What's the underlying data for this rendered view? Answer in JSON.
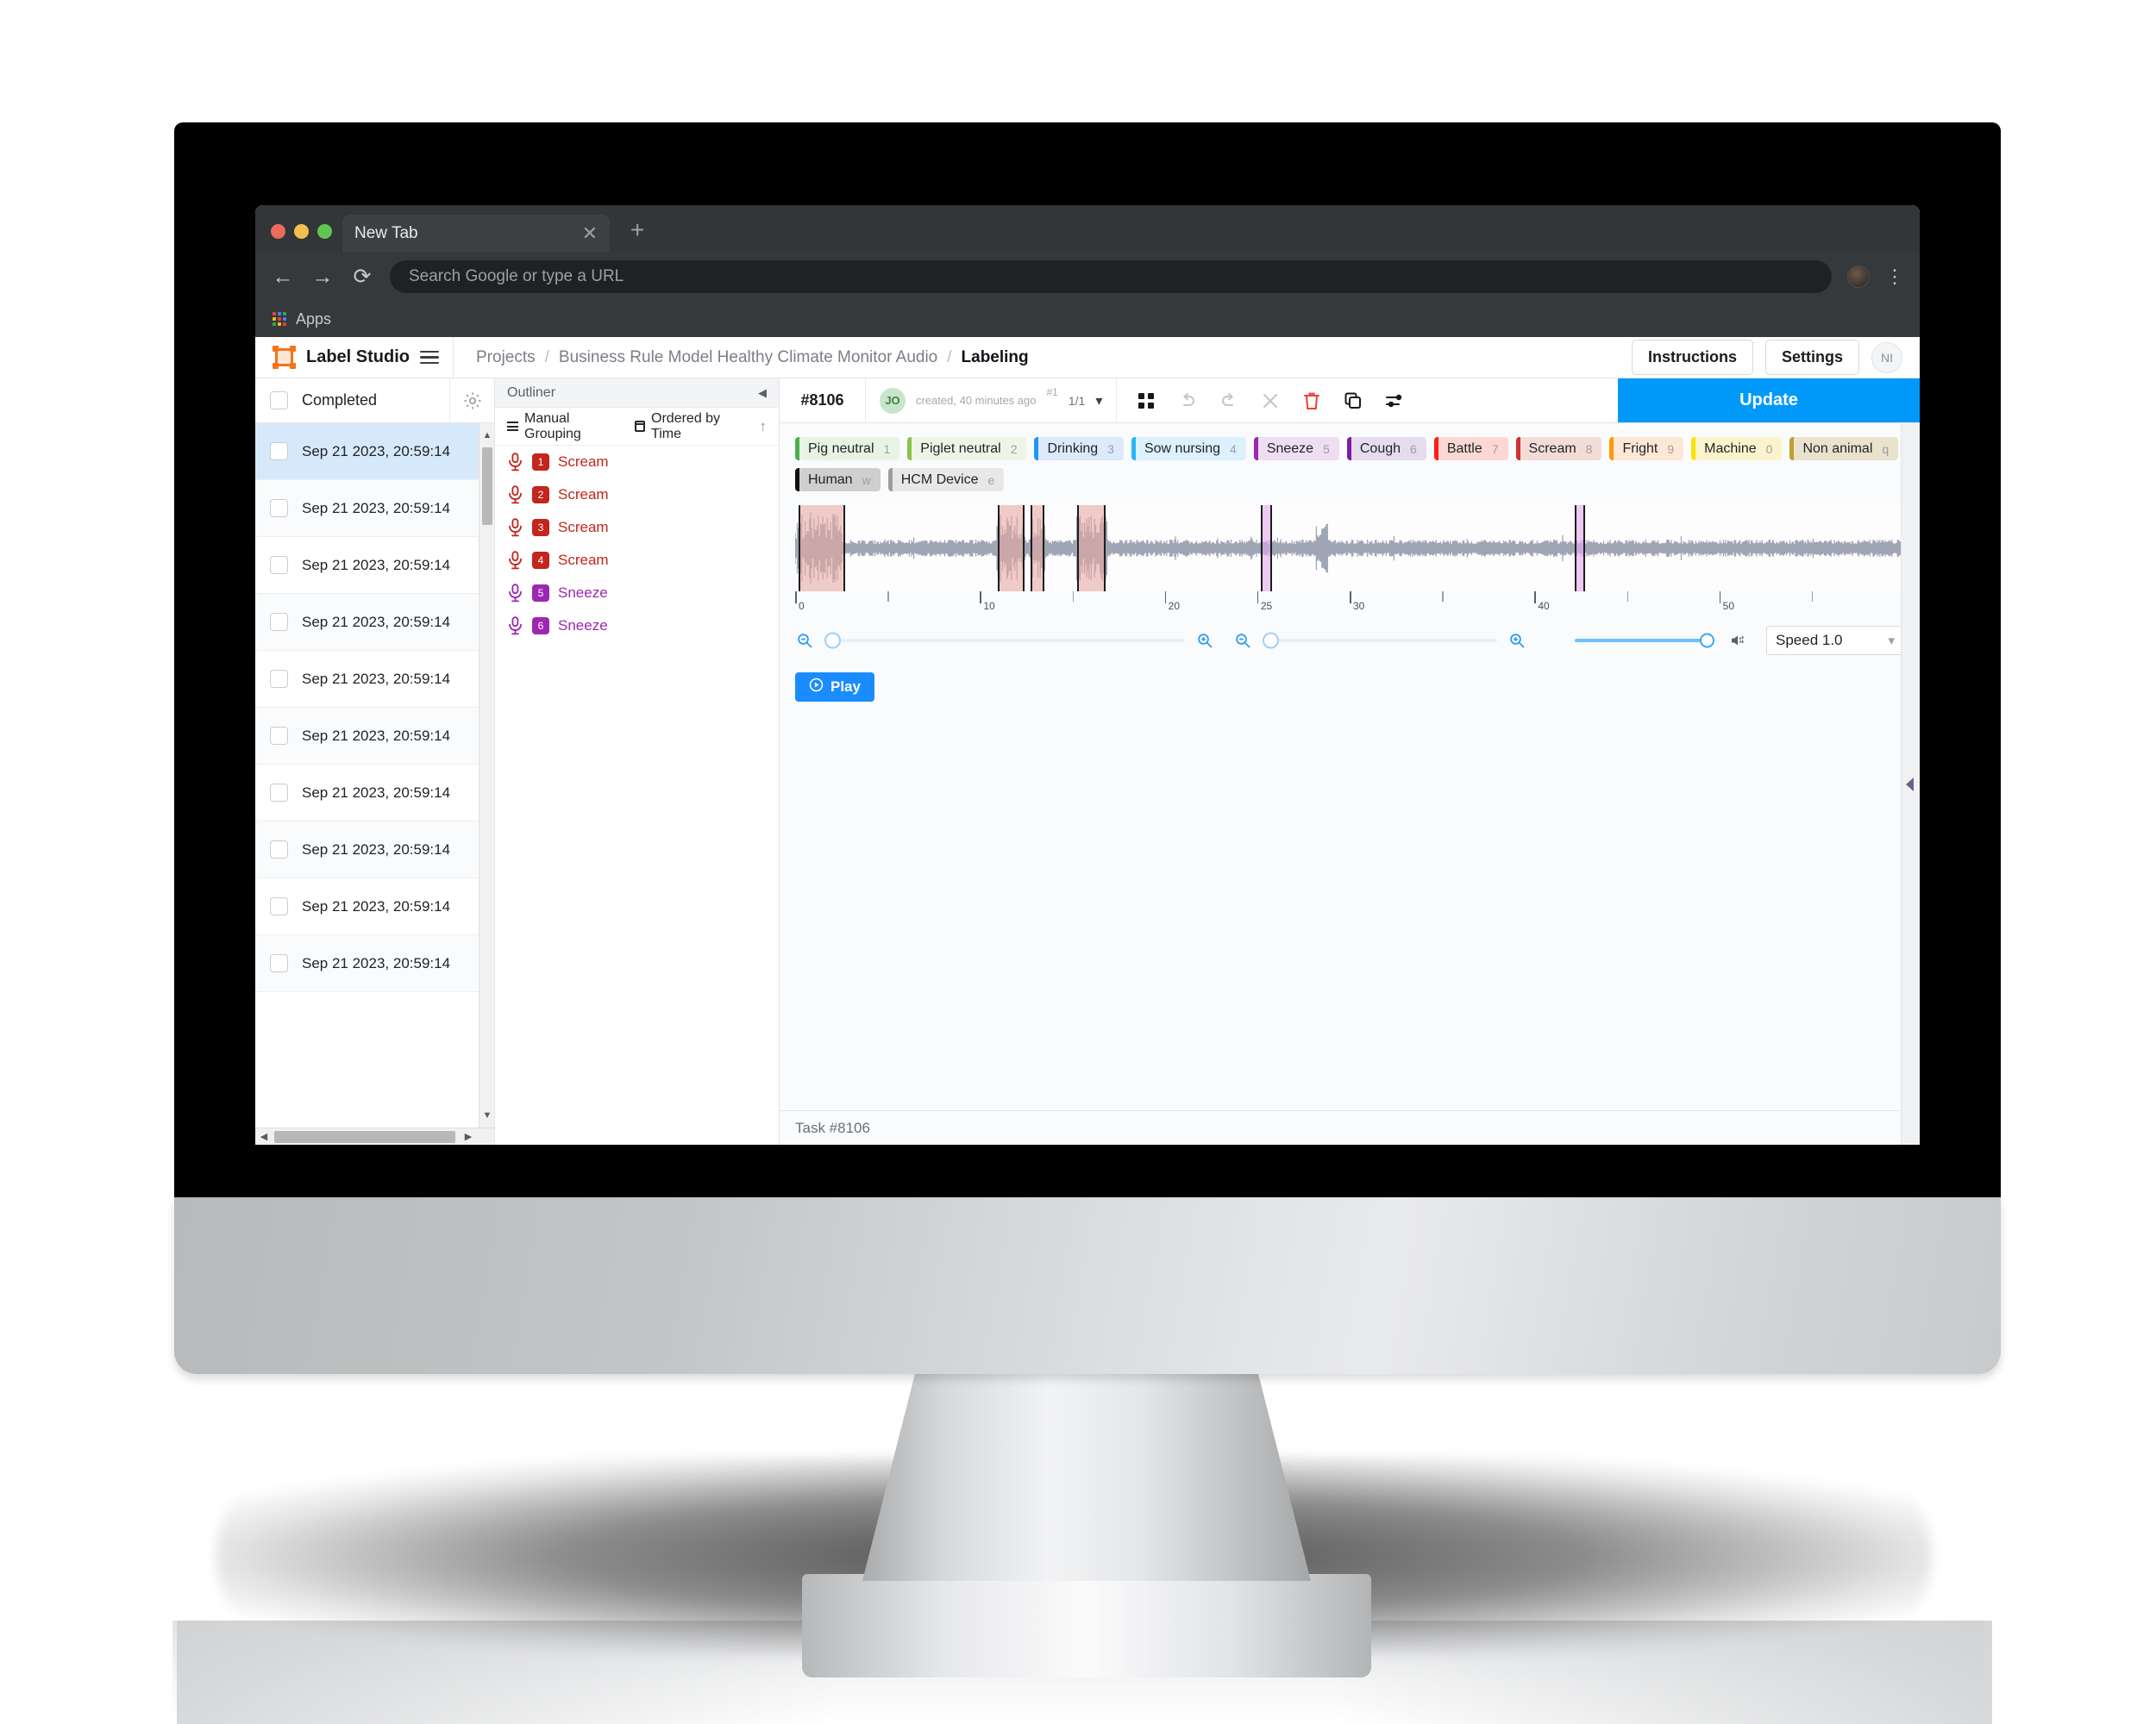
{
  "browser": {
    "tab_title": "New Tab",
    "close_icon": "close-icon",
    "new_tab_icon": "plus-icon",
    "back_icon": "←",
    "forward_icon": "→",
    "reload_icon": "⟳",
    "url_placeholder": "Search Google or type a URL",
    "url_value": "",
    "menu_icon": "kebab-menu-icon",
    "bookmark_label": "Apps"
  },
  "app": {
    "brand": "Label Studio",
    "menu_icon": "hamburger-icon",
    "breadcrumbs": [
      {
        "label": "Projects",
        "active": false
      },
      {
        "label": "Business Rule Model Healthy Climate Monitor Audio",
        "active": false
      },
      {
        "label": "Labeling",
        "active": true
      }
    ],
    "breadcrumb_sep": "/",
    "instructions_label": "Instructions",
    "settings_label": "Settings",
    "user_initials": "NI"
  },
  "tasklist": {
    "header_label": "Completed",
    "gear_icon": "gear-icon",
    "rows": [
      {
        "date": "Sep 21 2023, 20:59:14",
        "selected": true
      },
      {
        "date": "Sep 21 2023, 20:59:14",
        "selected": false
      },
      {
        "date": "Sep 21 2023, 20:59:14",
        "selected": false
      },
      {
        "date": "Sep 21 2023, 20:59:14",
        "selected": false
      },
      {
        "date": "Sep 21 2023, 20:59:14",
        "selected": false
      },
      {
        "date": "Sep 21 2023, 20:59:14",
        "selected": false
      },
      {
        "date": "Sep 21 2023, 20:59:14",
        "selected": false
      },
      {
        "date": "Sep 21 2023, 20:59:14",
        "selected": false
      },
      {
        "date": "Sep 21 2023, 20:59:14",
        "selected": false
      },
      {
        "date": "Sep 21 2023, 20:59:14",
        "selected": false
      }
    ]
  },
  "outliner": {
    "title": "Outliner",
    "collapse_icon": "collapse-left-icon",
    "grouping_label": "Manual Grouping",
    "ordering_label": "Ordered by Time",
    "sort_icon": "arrow-up-icon",
    "regions": [
      {
        "index": "1",
        "label": "Scream",
        "color": "#c2261c"
      },
      {
        "index": "2",
        "label": "Scream",
        "color": "#c2261c"
      },
      {
        "index": "3",
        "label": "Scream",
        "color": "#c2261c"
      },
      {
        "index": "4",
        "label": "Scream",
        "color": "#c2261c"
      },
      {
        "index": "5",
        "label": "Sneeze",
        "color": "#9c27b0"
      },
      {
        "index": "6",
        "label": "Sneeze",
        "color": "#9c27b0"
      }
    ]
  },
  "workspace": {
    "task_id": "#8106",
    "annotator_initials": "JO",
    "annotation_meta": "created, 40 minutes ago",
    "annotation_number": "#1",
    "annotation_page": "1/1",
    "caret_icon": "chevron-down-icon",
    "toolbar": [
      {
        "name": "grid-view-icon",
        "glyph": "grid",
        "state": "active"
      },
      {
        "name": "undo-icon",
        "glyph": "undo",
        "state": "muted"
      },
      {
        "name": "redo-icon",
        "glyph": "redo",
        "state": "muted"
      },
      {
        "name": "reset-icon",
        "glyph": "close",
        "state": "muted"
      },
      {
        "name": "delete-icon",
        "glyph": "trash",
        "state": "danger"
      },
      {
        "name": "copy-annotation-icon",
        "glyph": "copy",
        "state": "active"
      },
      {
        "name": "settings-sliders-icon",
        "glyph": "sliders",
        "state": "active"
      }
    ],
    "update_label": "Update",
    "status_text": "Task #8106",
    "collapse_handle_icon": "collapse-right-icon"
  },
  "labels": [
    {
      "name": "Pig neutral",
      "hotkey": "1",
      "accent": "#4caf50",
      "bg": "#e8f3e4"
    },
    {
      "name": "Piglet neutral",
      "hotkey": "2",
      "accent": "#8bc34a",
      "bg": "#eef5e7"
    },
    {
      "name": "Drinking",
      "hotkey": "3",
      "accent": "#2196f3",
      "bg": "#dceafb"
    },
    {
      "name": "Sow nursing",
      "hotkey": "4",
      "accent": "#29b6f6",
      "bg": "#dcf1fc"
    },
    {
      "name": "Sneeze",
      "hotkey": "5",
      "accent": "#9c27b0",
      "bg": "#eeddf3"
    },
    {
      "name": "Cough",
      "hotkey": "6",
      "accent": "#7b1fa2",
      "bg": "#e6dced"
    },
    {
      "name": "Battle",
      "hotkey": "7",
      "accent": "#ff1d14",
      "bg": "#fbd8d3"
    },
    {
      "name": "Scream",
      "hotkey": "8",
      "accent": "#d32f2f",
      "bg": "#f4dcd6"
    },
    {
      "name": "Fright",
      "hotkey": "9",
      "accent": "#ff9800",
      "bg": "#fde8d6"
    },
    {
      "name": "Machine",
      "hotkey": "0",
      "accent": "#ffe000",
      "bg": "#fbf3cc"
    },
    {
      "name": "Non animal",
      "hotkey": "q",
      "accent": "#c0a030",
      "bg": "#eae2cc"
    },
    {
      "name": "Human",
      "hotkey": "w",
      "accent": "#101010",
      "bg": "#cfcfcf"
    },
    {
      "name": "HCM Device",
      "hotkey": "e",
      "accent": "#9e9e9e",
      "bg": "#e8e8e8"
    }
  ],
  "audio": {
    "zoom_out_icon": "zoom-out-icon",
    "zoom_in_icon": "zoom-in-icon",
    "amp_zoom_out_icon": "zoom-out-icon",
    "amp_zoom_in_icon": "zoom-in-icon",
    "volume_icon": "volume-icon",
    "volume_value": 100,
    "speed_label": "Speed 1.0",
    "play_label": "Play",
    "play_icon": "play-circle-icon",
    "timeline_ticks": [
      "0",
      "10",
      "20",
      "25",
      "30",
      "40",
      "50"
    ],
    "regions": [
      {
        "start_pct": 0.3,
        "width_pct": 4.2,
        "color": "#e8a9a1",
        "border": "#1d1d1d"
      },
      {
        "start_pct": 18.3,
        "width_pct": 2.4,
        "color": "#e8a9a1",
        "border": "#1d1d1d"
      },
      {
        "start_pct": 21.2,
        "width_pct": 1.3,
        "color": "#e8a9a1",
        "border": "#1d1d1d"
      },
      {
        "start_pct": 25.4,
        "width_pct": 2.6,
        "color": "#e8a9a1",
        "border": "#1d1d1d"
      },
      {
        "start_pct": 42.0,
        "width_pct": 1.0,
        "color": "#e4a7ee",
        "border": "#1d1d1d"
      },
      {
        "start_pct": 70.3,
        "width_pct": 0.9,
        "color": "#e4a7ee",
        "border": "#1d1d1d"
      }
    ]
  }
}
